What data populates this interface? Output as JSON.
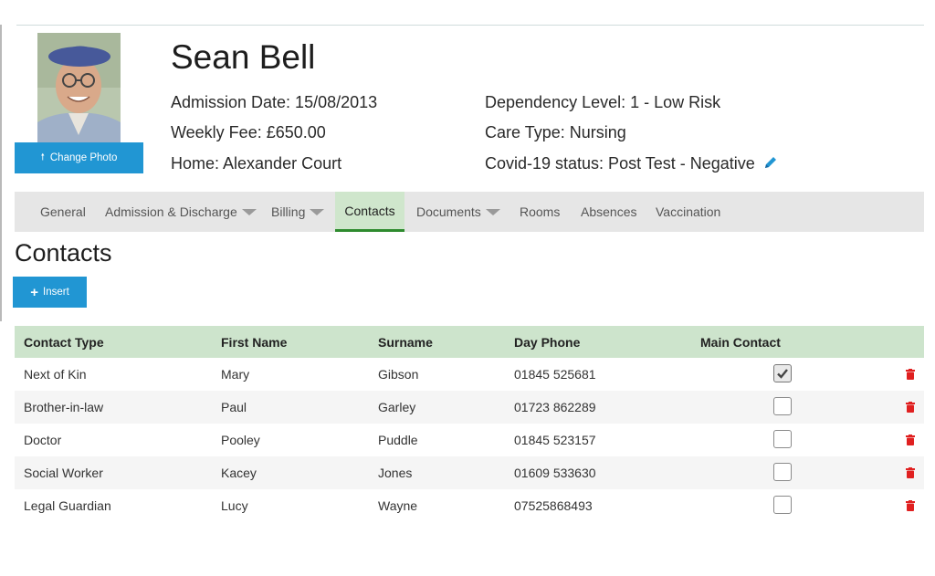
{
  "resident": {
    "name": "Sean Bell",
    "admission_date": "Admission Date: 15/08/2013",
    "weekly_fee": "Weekly Fee: £650.00",
    "home": "Home: Alexander Court",
    "dependency_level": "Dependency Level: 1 - Low Risk",
    "care_type": "Care Type: Nursing",
    "covid_status": "Covid-19 status: Post Test - Negative"
  },
  "photo": {
    "change_photo_label": "Change Photo",
    "change_photo_icon": "upload-arrow-icon"
  },
  "tabs": [
    {
      "label": "General",
      "dropdown": false
    },
    {
      "label": "Admission & Discharge",
      "dropdown": true
    },
    {
      "label": "Billing",
      "dropdown": true
    },
    {
      "label": "Contacts",
      "dropdown": false,
      "active": true
    },
    {
      "label": "Documents",
      "dropdown": true
    },
    {
      "label": "Rooms",
      "dropdown": false
    },
    {
      "label": "Absences",
      "dropdown": false
    },
    {
      "label": "Vaccination",
      "dropdown": false
    }
  ],
  "contacts": {
    "title": "Contacts",
    "insert_label": "Insert",
    "columns": [
      "Contact Type",
      "First Name",
      "Surname",
      "Day Phone",
      "Main Contact"
    ],
    "rows": [
      {
        "type": "Next of Kin",
        "first": "Mary",
        "surname": "Gibson",
        "phone": "01845 525681",
        "main": true
      },
      {
        "type": "Brother-in-law",
        "first": "Paul",
        "surname": "Garley",
        "phone": "01723 862289",
        "main": false
      },
      {
        "type": "Doctor",
        "first": "Pooley",
        "surname": "Puddle",
        "phone": "01845 523157",
        "main": false
      },
      {
        "type": "Social Worker",
        "first": "Kacey",
        "surname": "Jones",
        "phone": "01609 533630",
        "main": false
      },
      {
        "type": "Legal Guardian",
        "first": "Lucy",
        "surname": "Wayne",
        "phone": "07525868493",
        "main": false
      }
    ]
  },
  "colors": {
    "primary_button": "#2196d3",
    "table_header": "#cde4cc",
    "active_tab_underline": "#2e8b2e",
    "delete_icon": "#e02020",
    "edit_icon": "#2196d3"
  }
}
